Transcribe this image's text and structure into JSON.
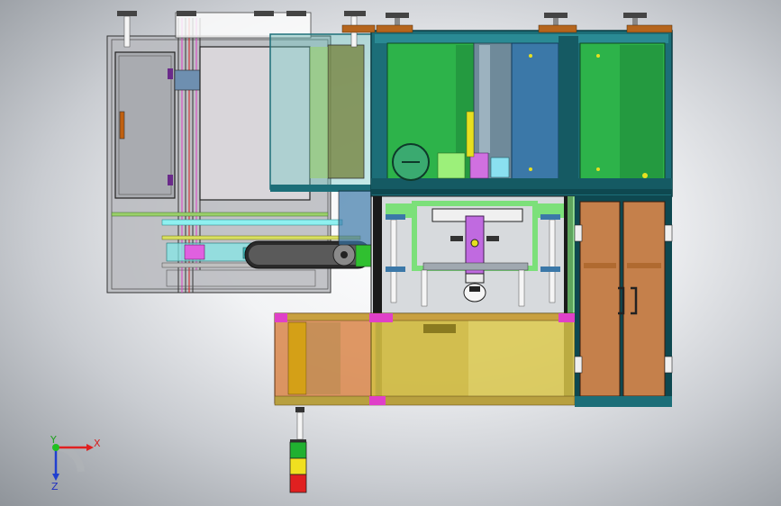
{
  "viewport": {
    "background": "#c9ccd1"
  },
  "triad": {
    "x_label": "X",
    "y_label": "Y",
    "z_label": "Z",
    "x_color": "#e02020",
    "y_color": "#20c020",
    "z_color": "#2040d0"
  },
  "colors": {
    "frame_teal": "#1c6e78",
    "green_panel": "#2db34a",
    "blue_panel": "#3b78a8",
    "gray_door": "#a9abb0",
    "orange_panel": "#d9864a",
    "yellow_panel": "#d8c64a",
    "gold_panel": "#d4a017",
    "pink_bracket": "#e040c8",
    "light_green_frame": "#7ce07a",
    "copper_cap": "#b5651d"
  },
  "signal_tower": {
    "lamps": [
      "#e02020",
      "#f0e020",
      "#20b030"
    ]
  }
}
